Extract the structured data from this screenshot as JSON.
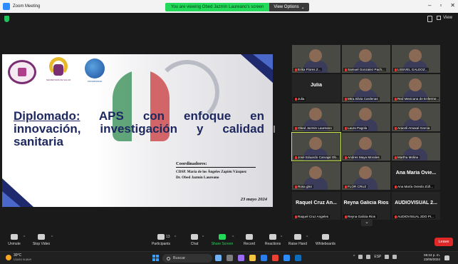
{
  "window": {
    "title": "Zoom Meeting",
    "controls": [
      "–",
      "▫",
      "✕"
    ]
  },
  "share_banner": {
    "message": "You are viewing Obed Jazmín Laureano's screen",
    "options_label": "View Options",
    "options_caret": "⌄"
  },
  "top_bar": {
    "view_label": "View"
  },
  "slide": {
    "logo2_caption": "SECRETARÍA DE SALUD",
    "logo3_caption": "UNIVERSIDAD",
    "title_word1": "Diplomado:",
    "title_rest": " APS con enfoque en innovación, investigación y calidad sanitaria",
    "coordinators_heading": "Coordinadores:",
    "coordinator_1": "CDSP. María de los Ángeles Zapién Vázquez",
    "coordinator_2": "Dr. Obed Jazmín Laureano",
    "date": "23 mayo 2024"
  },
  "gallery": {
    "tiles": [
      {
        "type": "video",
        "name": "Erika Flores Z..."
      },
      {
        "type": "video",
        "name": "Samuel Gonzalez Pach..."
      },
      {
        "type": "video",
        "name": "LISSVEL GALDOZ..."
      },
      {
        "type": "text",
        "big": "Julia",
        "name": "Julia"
      },
      {
        "type": "video",
        "name": "Mtra.Silvia Cardenas"
      },
      {
        "type": "video",
        "name": "Red Mexicana de Enferme..."
      },
      {
        "type": "video",
        "name": "Obed Jazmin Laureano"
      },
      {
        "type": "video",
        "name": "Laura Pagola"
      },
      {
        "type": "video",
        "name": "Araceli Amaxal Garcia"
      },
      {
        "type": "video",
        "name": "José Eduardo Carvajal Ob...",
        "active": true
      },
      {
        "type": "video",
        "name": "Andres Maya Morales"
      },
      {
        "type": "video",
        "name": "Martha Molina"
      },
      {
        "type": "video",
        "name": "Rosa glez"
      },
      {
        "type": "video",
        "name": "FLOR CRUZ"
      },
      {
        "type": "text",
        "big": "Ana María Ovie...",
        "name": "Ana María Oviedo Zúñ..."
      },
      {
        "type": "text",
        "big": "Raquel Cruz An...",
        "name": "Raquel Cruz Angeles"
      },
      {
        "type": "text",
        "big": "Reyna Galicia Rios",
        "name": "Reyna Galicia Rios"
      },
      {
        "type": "text",
        "big": "AUDIOVISUAL 2...",
        "name": "AUDIOVISUAL 2DO PI..."
      }
    ],
    "next_page": "⌄"
  },
  "toolbar": {
    "unmute": "Unmute",
    "stop_video": "Stop Video",
    "participants": "Participants",
    "participants_count": "13",
    "chat": "Chat",
    "share_screen": "Share Screen",
    "record": "Record",
    "reactions": "Reactions",
    "raise_hand": "Raise Hand",
    "whiteboards": "Whiteboards",
    "leave": "Leave",
    "caret": "^"
  },
  "taskbar": {
    "temperature": "30°C",
    "weather": "Lluvia suave",
    "search_placeholder": "Buscar",
    "language": "ESP",
    "time": "05:24 p. m.",
    "date": "23/05/2024"
  },
  "colors": {
    "zoom_green": "#23d959",
    "leave_red": "#e02828",
    "slide_navy": "#1e2860"
  }
}
